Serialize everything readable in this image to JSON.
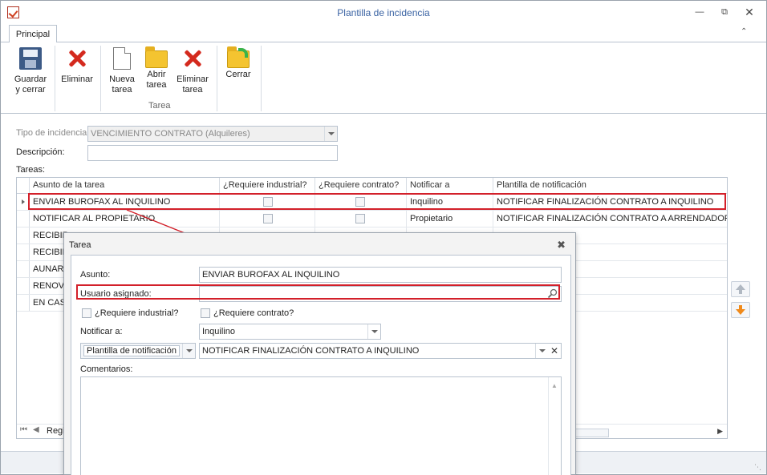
{
  "window": {
    "title": "Plantilla de incidencia"
  },
  "tabs": [
    {
      "label": "Principal"
    }
  ],
  "ribbon": {
    "guardar_line1": "Guardar",
    "guardar_line2": "y cerrar",
    "eliminar": "Eliminar",
    "nueva_line1": "Nueva",
    "nueva_line2": "tarea",
    "abrir_line1": "Abrir",
    "abrir_line2": "tarea",
    "eliminar_tarea_line1": "Eliminar",
    "eliminar_tarea_line2": "tarea",
    "cerrar": "Cerrar",
    "group_tarea": "Tarea"
  },
  "form": {
    "tipo_label": "Tipo de incidencia",
    "tipo_value": "VENCIMIENTO CONTRATO (Alquileres)",
    "descripcion_label": "Descripción:",
    "descripcion_value": "",
    "tareas_label": "Tareas:"
  },
  "grid": {
    "columns": [
      "Asunto de la tarea",
      "¿Requiere industrial?",
      "¿Requiere contrato?",
      "Notificar a",
      "Plantilla de notificación"
    ],
    "rows": [
      {
        "asunto": "ENVIAR BUROFAX AL INQUILINO",
        "notificar": "Inquilino",
        "plantilla": "NOTIFICAR FINALIZACIÓN CONTRATO A INQUILINO"
      },
      {
        "asunto": "NOTIFICAR AL PROPIETARIO",
        "notificar": "Propietario",
        "plantilla": "NOTIFICAR FINALIZACIÓN CONTRATO A ARRENDADOR"
      },
      {
        "asunto": "RECIBIR",
        "notificar": "",
        "plantilla": ""
      },
      {
        "asunto": "RECIBIR",
        "notificar": "",
        "plantilla": ""
      },
      {
        "asunto": "AUNAR",
        "notificar": "",
        "plantilla": ""
      },
      {
        "asunto": "RENOVA",
        "notificar": "",
        "plantilla": ""
      },
      {
        "asunto": "EN CASO",
        "notificar": "",
        "plantilla": ""
      }
    ],
    "nav_text": "Regi"
  },
  "dialog": {
    "title": "Tarea",
    "asunto_label": "Asunto:",
    "asunto_value": "ENVIAR BUROFAX AL INQUILINO",
    "usuario_label": "Usuario asignado:",
    "usuario_value": "",
    "req_industrial": "¿Requiere industrial?",
    "req_contrato": "¿Requiere contrato?",
    "notificar_label": "Notificar a:",
    "notificar_value": "Inquilino",
    "plantilla_button": "Plantilla de notificación",
    "plantilla_value": "NOTIFICAR FINALIZACIÓN CONTRATO A INQUILINO",
    "comentarios_label": "Comentarios:"
  },
  "colors": {
    "highlight": "#d3202a",
    "title_text": "#3a63a3"
  }
}
